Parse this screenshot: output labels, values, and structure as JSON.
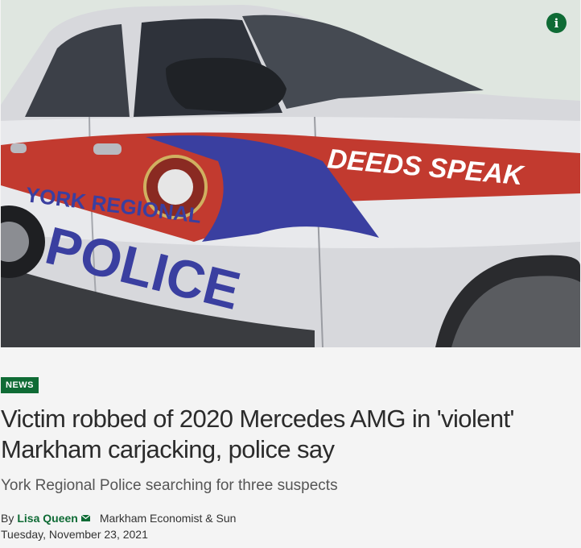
{
  "hero": {
    "car_text_slogan": "DEEDS SPEAK",
    "car_text_org": "YORK REGIONAL",
    "car_text_police": "POLICE",
    "info_label": "i"
  },
  "article": {
    "section_badge": "NEWS",
    "headline": "Victim robbed of 2020 Mercedes AMG in 'violent' Markham carjacking, police say",
    "subhead": "York Regional Police searching for three suspects",
    "byline_prefix": "By",
    "author": "Lisa Queen",
    "publication": "Markham Economist & Sun",
    "date": "Tuesday, November 23, 2021"
  },
  "colors": {
    "brand_green": "#0f6b35",
    "stripe_red": "#c23a2f",
    "stripe_blue": "#3a3fa0"
  }
}
